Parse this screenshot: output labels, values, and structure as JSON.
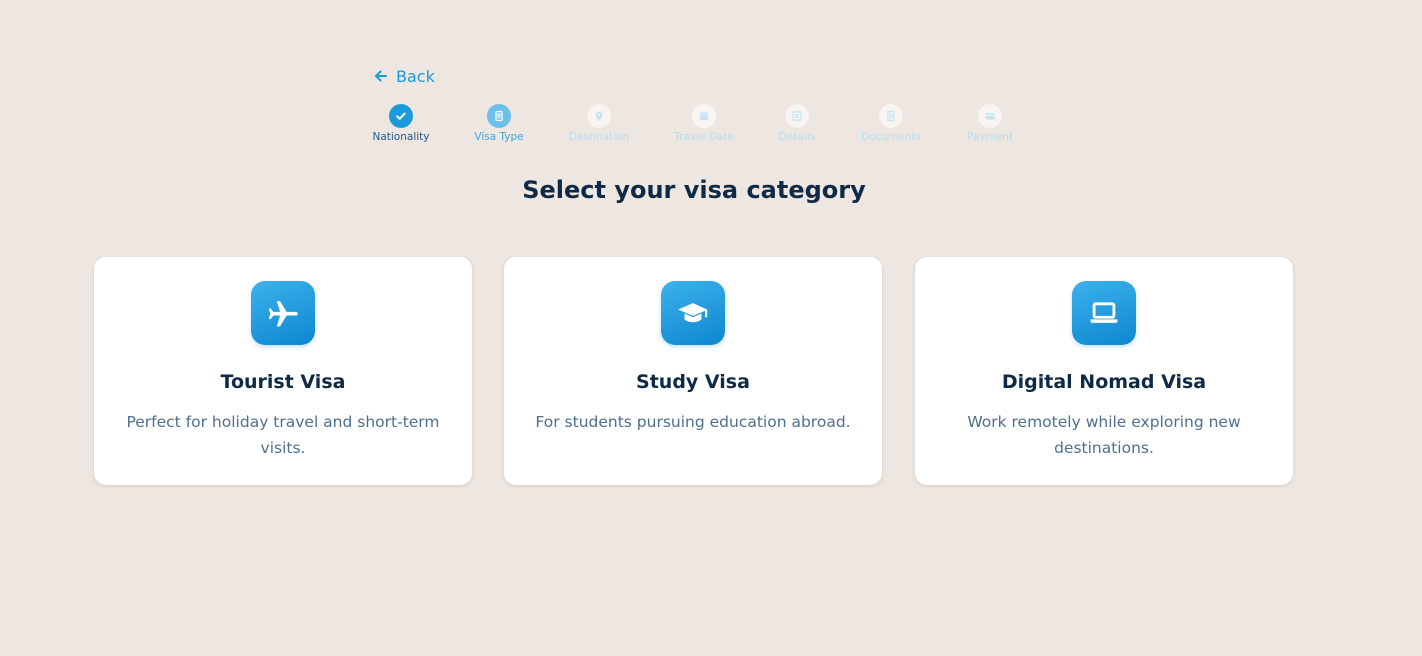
{
  "nav": {
    "back_label": "Back",
    "back_icon": "arrow-left-icon"
  },
  "stepper": {
    "steps": [
      {
        "label": "Nationality",
        "state": "done",
        "icon": "check-icon"
      },
      {
        "label": "Visa Type",
        "state": "current",
        "icon": "passport-icon"
      },
      {
        "label": "Destination",
        "state": "pending",
        "icon": "location-pin-icon"
      },
      {
        "label": "Travel Date",
        "state": "pending",
        "icon": "calendar-icon"
      },
      {
        "label": "Details",
        "state": "pending",
        "icon": "list-icon"
      },
      {
        "label": "Documents",
        "state": "pending",
        "icon": "passport-icon"
      },
      {
        "label": "Payment",
        "state": "pending",
        "icon": "credit-card-icon"
      }
    ]
  },
  "page": {
    "title": "Select your visa category"
  },
  "categories": [
    {
      "title": "Tourist Visa",
      "description": "Perfect for holiday travel and short-term visits.",
      "icon": "airplane-icon"
    },
    {
      "title": "Study Visa",
      "description": "For students pursuing education abroad.",
      "icon": "graduation-cap-icon"
    },
    {
      "title": "Digital Nomad Visa",
      "description": "Work remotely while exploring new destinations.",
      "icon": "laptop-icon"
    }
  ],
  "colors": {
    "background": "#EEE6E0",
    "accent": "#1A9AD9",
    "heading": "#0E2A47",
    "body_text": "#4E6F8F",
    "card": "#FFFFFF"
  }
}
